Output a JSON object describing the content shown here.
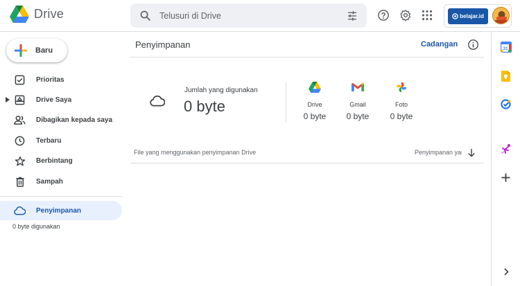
{
  "app": {
    "name": "Drive"
  },
  "search": {
    "placeholder": "Telusuri di Drive"
  },
  "account": {
    "org_label": "belajar.id"
  },
  "new_button": {
    "label": "Baru"
  },
  "sidebar": {
    "items": [
      {
        "label": "Prioritas",
        "icon": "check-box-icon"
      },
      {
        "label": "Drive Saya",
        "icon": "my-drive-icon"
      },
      {
        "label": "Dibagikan kepada saya",
        "icon": "people-icon"
      },
      {
        "label": "Terbaru",
        "icon": "clock-icon"
      },
      {
        "label": "Berbintang",
        "icon": "star-icon"
      },
      {
        "label": "Sampah",
        "icon": "trash-icon"
      },
      {
        "label": "Penyimpanan",
        "icon": "cloud-icon",
        "active": true
      }
    ],
    "storage_usage": "0 byte digunakan"
  },
  "main": {
    "title": "Penyimpanan",
    "backup_link": "Cadangan",
    "used_label": "Jumlah yang digunakan",
    "used_value": "0 byte",
    "services": [
      {
        "name": "Drive",
        "value": "0 byte",
        "icon": "drive-logo-icon"
      },
      {
        "name": "Gmail",
        "value": "0 byte",
        "icon": "gmail-logo-icon"
      },
      {
        "name": "Foto",
        "value": "0 byte",
        "icon": "photos-logo-icon"
      }
    ],
    "files_header": "File yang menggunakan penyimpanan Drive",
    "sort_label": "Penyimpanan yang digunakan"
  },
  "colors": {
    "accent": "#1a57a8",
    "active_bg": "#e8f0fe",
    "divider": "#dadce0",
    "search_bg": "#eef0f3"
  }
}
